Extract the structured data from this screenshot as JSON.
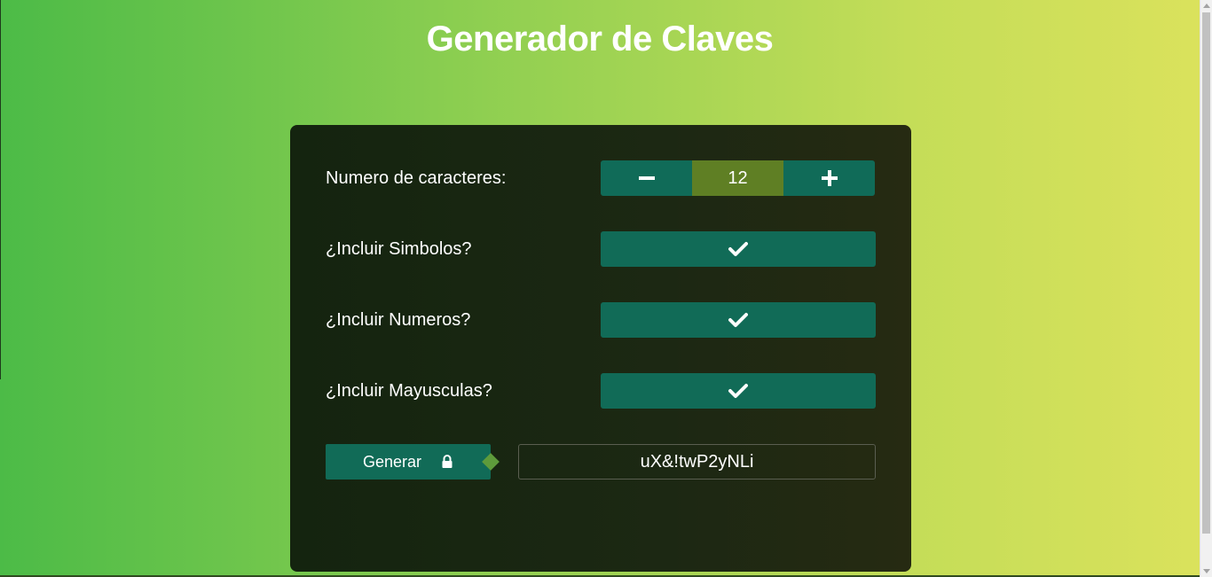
{
  "page": {
    "title": "Generador de Claves"
  },
  "form": {
    "length": {
      "label": "Numero de caracteres:",
      "value": "12",
      "decrement_icon": "minus-icon",
      "increment_icon": "plus-icon"
    },
    "symbols": {
      "label": "¿Incluir Simbolos?",
      "checked": true,
      "icon": "check-icon"
    },
    "numbers": {
      "label": "¿Incluir Numeros?",
      "checked": true,
      "icon": "check-icon"
    },
    "uppercase": {
      "label": "¿Incluir Mayusculas?",
      "checked": true,
      "icon": "check-icon"
    },
    "generate": {
      "label": "Generar",
      "icon": "lock-icon"
    },
    "result": {
      "value": "uX&!twP2yNLi"
    }
  },
  "colors": {
    "accent_teal": "#116b57",
    "value_olive": "#5f7f24",
    "card_bg": "#1a2612",
    "bg_gradient_start": "#4cbb47",
    "bg_gradient_end": "#dbe25c"
  }
}
